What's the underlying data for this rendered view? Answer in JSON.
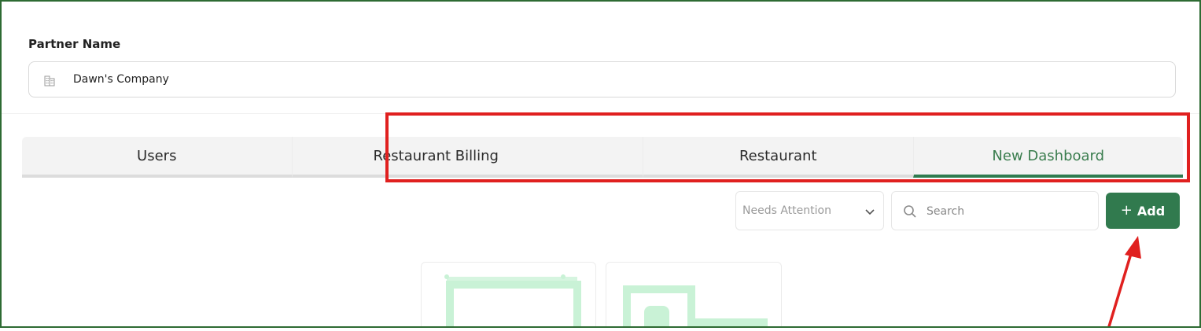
{
  "partner": {
    "label": "Partner Name",
    "value": "Dawn's Company",
    "icon": "building-icon"
  },
  "tabs": [
    {
      "label": "Users",
      "active": false
    },
    {
      "label": "Restaurant Billing",
      "active": false
    },
    {
      "label": "Restaurant",
      "active": false
    },
    {
      "label": "New Dashboard",
      "active": true
    }
  ],
  "toolbar": {
    "filter_value": "Needs Attention",
    "search_placeholder": "Search",
    "add_label": "Add"
  },
  "colors": {
    "frame_border": "#2e6b33",
    "accent_green": "#317a4e",
    "active_tab_text": "#3a7d4e",
    "highlight_red": "#e0201f",
    "illustration_green": "#c9f2d6"
  },
  "icons": [
    "building-icon",
    "chevron-down-icon",
    "search-icon",
    "plus-icon"
  ]
}
